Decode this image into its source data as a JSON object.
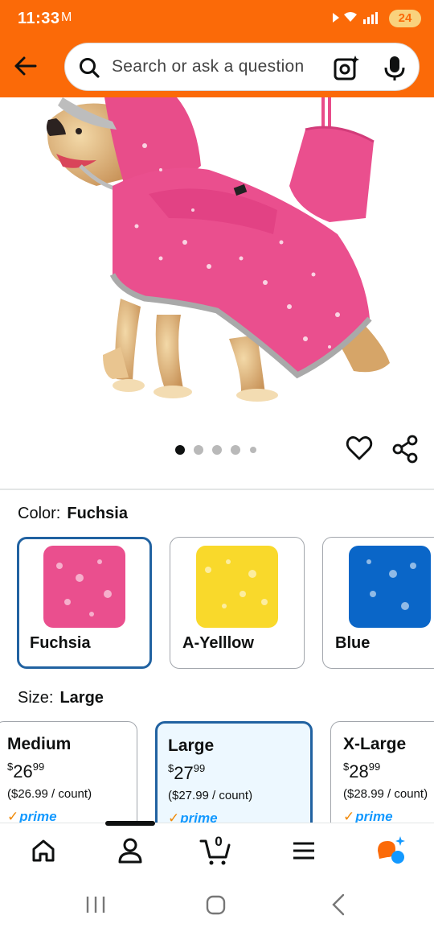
{
  "status_bar": {
    "time": "11:33",
    "mail_glyph": "M",
    "battery": "24"
  },
  "header": {
    "search_placeholder": "Search or ask a question",
    "brand_color": "#fb6a08"
  },
  "gallery": {
    "image_count": 5,
    "active_index": 0
  },
  "color_selector": {
    "label": "Color:",
    "selected": "Fuchsia",
    "options": [
      {
        "name": "Fuchsia",
        "color": "#ea4f8e",
        "selected": true
      },
      {
        "name": "A-Yelllow",
        "color": "#f9d92b",
        "selected": false
      },
      {
        "name": "Blue",
        "color": "#0a66c8",
        "selected": false
      }
    ]
  },
  "size_selector": {
    "label": "Size:",
    "selected": "Large",
    "options": [
      {
        "name": "Medium",
        "currency": "$",
        "whole": "26",
        "fraction": "99",
        "unit_price": "($26.99 / count)",
        "badge": "prime",
        "selected": false
      },
      {
        "name": "Large",
        "currency": "$",
        "whole": "27",
        "fraction": "99",
        "unit_price": "($27.99 / count)",
        "badge": "prime",
        "selected": true
      },
      {
        "name": "X-Large",
        "currency": "$",
        "whole": "28",
        "fraction": "99",
        "unit_price": "($28.99 / count)",
        "badge": "prime",
        "selected": false
      }
    ]
  },
  "bottom_nav": {
    "items": [
      "home-icon",
      "account-icon",
      "cart-icon",
      "menu-icon",
      "rufus-icon"
    ],
    "cart_count": "0"
  }
}
